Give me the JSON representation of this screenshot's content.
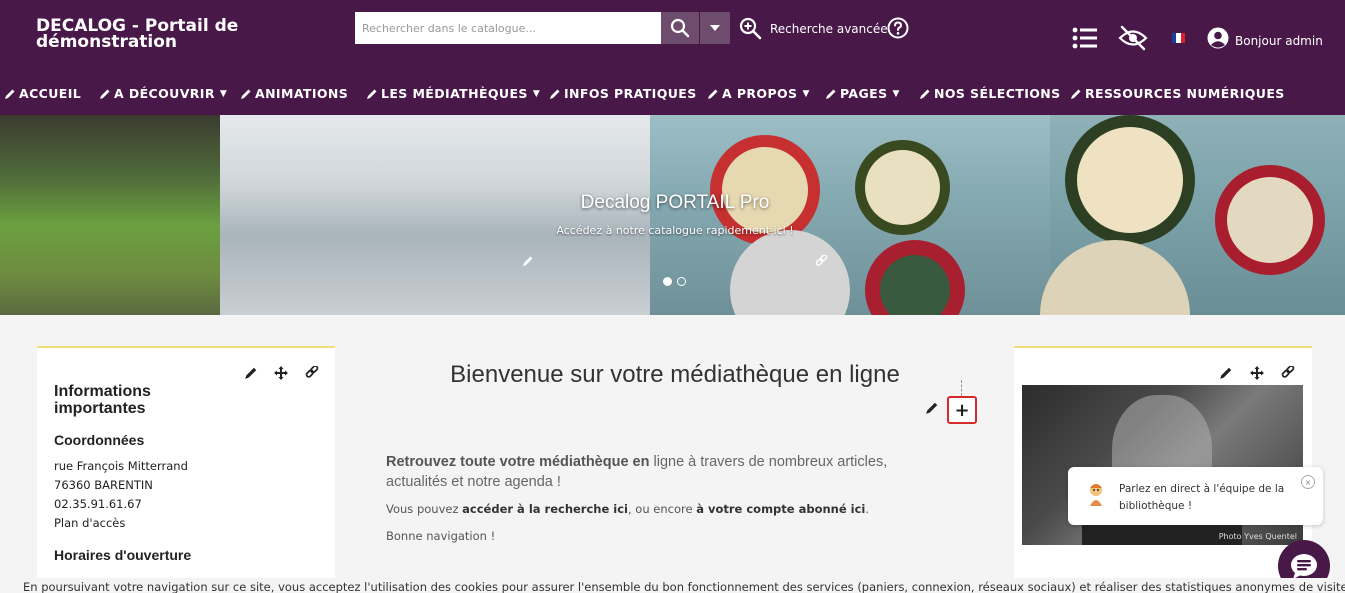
{
  "header": {
    "brand": "DECALOG - Portail de démonstration",
    "search_placeholder": "Rechercher dans le catalogue...",
    "advanced_search": "Recherche avancée",
    "language_icon": "french-flag",
    "user_greeting": "Bonjour admin"
  },
  "nav": {
    "items": [
      {
        "label": "ACCUEIL",
        "dropdown": false
      },
      {
        "label": "A DÉCOUVRIR",
        "dropdown": true
      },
      {
        "label": "ANIMATIONS",
        "dropdown": false
      },
      {
        "label": "LES MÉDIATHÈQUES",
        "dropdown": true
      },
      {
        "label": "INFOS PRATIQUES",
        "dropdown": false
      },
      {
        "label": "A PROPOS",
        "dropdown": true
      },
      {
        "label": "PAGES",
        "dropdown": true
      },
      {
        "label": "NOS SÉLECTIONS",
        "dropdown": false
      },
      {
        "label": "RESSOURCES NUMÉRIQUES",
        "dropdown": false
      }
    ]
  },
  "banner": {
    "title": "Decalog PORTAIL Pro",
    "subtitle": "Accédez à notre catalogue rapidement ici !",
    "slide_count": 2,
    "active_slide": 1
  },
  "left_card": {
    "title": "Informations importantes",
    "section_contact": "Coordonnées",
    "address_line1": "rue François Mitterrand",
    "address_line2": "76360 BARENTIN",
    "phone": "02.35.91.61.67",
    "map_link": "Plan d'accès",
    "section_hours": "Horaires d'ouverture"
  },
  "main": {
    "title": "Bienvenue sur votre médiathèque en ligne",
    "intro_bold": "Retrouvez toute votre médiathèque en",
    "intro_rest": " ligne à travers de nombreux articles, actualités et notre agenda !",
    "p2_a": "Vous pouvez ",
    "p2_b": "accéder à la recherche ",
    "p2_c": "ici",
    "p2_d": ", ou encore ",
    "p2_e": "à votre compte abonné ",
    "p2_f": "ici",
    "p2_g": ".",
    "p3": "Bonne navigation !",
    "add_button": "+"
  },
  "right_card": {
    "photo_caption": "Photo Yves Quentel"
  },
  "chat": {
    "message": "Parlez en direct à l'équipe de la bibliothèque !",
    "close": "×"
  },
  "cookie_bar": {
    "text": "En poursuivant votre navigation sur ce site, vous acceptez l'utilisation des cookies pour assurer l'ensemble du bon fonctionnement des services (paniers, connexion, réseaux sociaux) et réaliser des statistiques anonymes de visites. X"
  },
  "colors": {
    "brand_purple": "#481848",
    "search_button": "#6e4c6e",
    "card_accent": "#f2df7a",
    "highlight_red": "#d42a2a"
  }
}
